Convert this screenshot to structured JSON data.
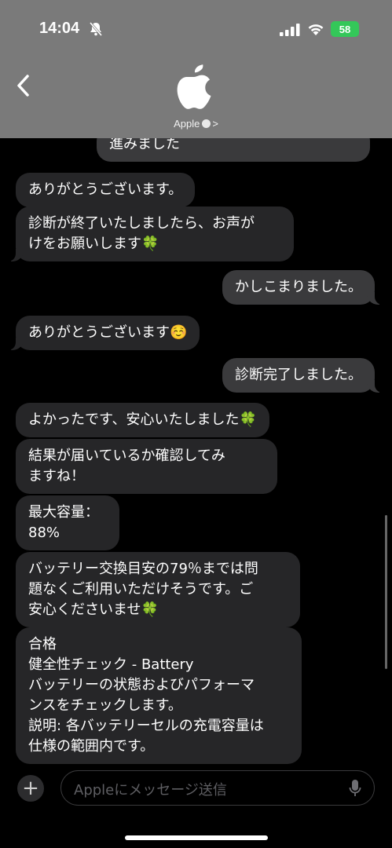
{
  "status_bar": {
    "time": "14:04",
    "battery": "58"
  },
  "header": {
    "contact_name": "Apple",
    "chevron": ">"
  },
  "messages": [
    {
      "from": "out",
      "text": "進みました"
    },
    {
      "from": "in",
      "text": "ありがとうございます。"
    },
    {
      "from": "in",
      "text": "診断が終了いたしましたら、お声が\nけをお願いします🍀"
    },
    {
      "from": "out",
      "text": "かしこまりました。"
    },
    {
      "from": "in",
      "text": "ありがとうございます☺️"
    },
    {
      "from": "out",
      "text": "診断完了しました。"
    },
    {
      "from": "in",
      "text": "よかったです、安心いたしました🍀"
    },
    {
      "from": "in",
      "text": "結果が届いているか確認してみ\nますね！"
    },
    {
      "from": "in",
      "text": "最大容量：\n88%"
    },
    {
      "from": "in",
      "text": "バッテリー交換目安の79％までは問\n題なくご利用いただけそうです。ご\n安心くださいませ🍀"
    },
    {
      "from": "in",
      "text": "合格\n健全性チェック - Battery\nバッテリーの状態およびパフォーマ\nンスをチェックします。\n説明: 各バッテリーセルの充電容量は\n仕様の範囲内です。"
    }
  ],
  "input": {
    "placeholder": "Appleにメッセージ送信",
    "plus_label": "+"
  },
  "colors": {
    "header_bg": "#7a7a7a",
    "incoming_bubble": "#262628",
    "outgoing_bubble": "#3a3a3c",
    "battery": "#34c759"
  },
  "icons": [
    "bell-off-icon",
    "signal-icon",
    "wifi-icon",
    "battery-icon",
    "back-chevron-icon",
    "apple-logo-icon",
    "verified-icon",
    "plus-icon",
    "mic-icon"
  ]
}
